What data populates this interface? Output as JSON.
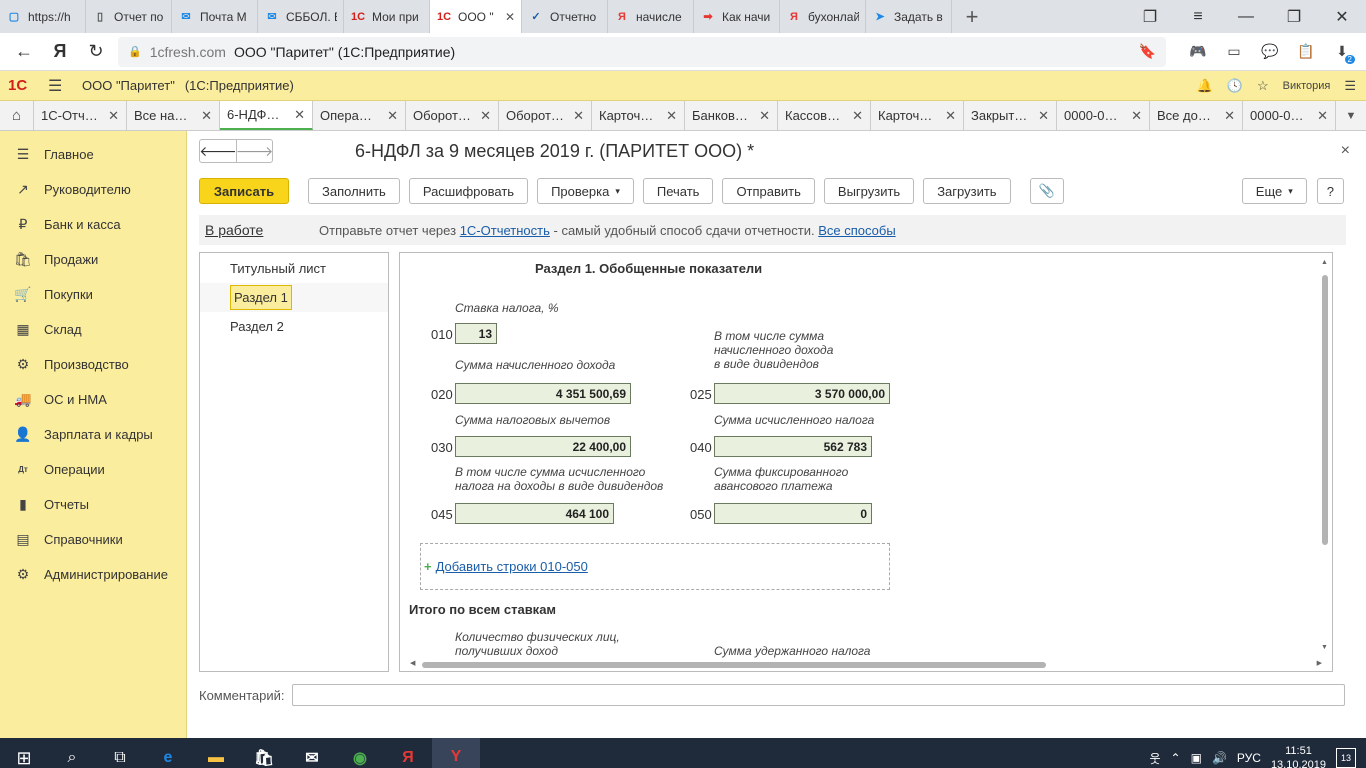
{
  "browser": {
    "tabs": [
      {
        "icon": "ie-icon",
        "glyph": "▢",
        "color": "#1e88e5",
        "title": "https://h"
      },
      {
        "icon": "doc-icon",
        "glyph": "▯",
        "color": "#555",
        "title": "Отчет по"
      },
      {
        "icon": "mail-icon",
        "glyph": "✉",
        "color": "#1e88e5",
        "title": "Почта М"
      },
      {
        "icon": "mail-icon",
        "glyph": "✉",
        "color": "#1e88e5",
        "title": "СББОЛ. В"
      },
      {
        "icon": "onec-icon",
        "glyph": "1С",
        "color": "#d3201a",
        "title": "Мои при"
      },
      {
        "icon": "onec-icon",
        "glyph": "1С",
        "color": "#d3201a",
        "title": "ООО \"",
        "active": true
      },
      {
        "icon": "check-icon",
        "glyph": "✓",
        "color": "#1a5da8",
        "title": "Отчетно"
      },
      {
        "icon": "yandex-icon",
        "glyph": "Я",
        "color": "#e53935",
        "title": "начисле"
      },
      {
        "icon": "arrow-icon",
        "glyph": "➡",
        "color": "#e53935",
        "title": "Как начи"
      },
      {
        "icon": "yandex-icon",
        "glyph": "Я",
        "color": "#e53935",
        "title": "бухонлай"
      },
      {
        "icon": "telegram-icon",
        "glyph": "➤",
        "color": "#1e88e5",
        "title": "Задать в"
      }
    ],
    "new_tab": "+",
    "window": {
      "collections": "❐",
      "menu": "≡",
      "minimize": "—",
      "restore": "❐",
      "close": "✕"
    },
    "nav": {
      "back": "←",
      "yandex": "Я",
      "reload": "↻"
    },
    "address": {
      "lock": "🔒",
      "domain": "1cfresh.com",
      "page_title": "ООО \"Паритет\" (1С:Предприятие)",
      "bookmark": "🔖"
    },
    "extensions": [
      {
        "name": "gamepad-icon",
        "glyph": "🎮"
      },
      {
        "name": "battery-icon",
        "glyph": "▭"
      },
      {
        "name": "chat-icon",
        "glyph": "💬"
      },
      {
        "name": "clipboard-icon",
        "glyph": "📋"
      },
      {
        "name": "download-icon",
        "glyph": "⬇",
        "badge": "2"
      }
    ]
  },
  "onec": {
    "logo": "1С",
    "menu": "☰",
    "app_name": "ООО \"Паритет\"",
    "app_suffix": "(1С:Предприятие)",
    "icons": {
      "bell": "🔔",
      "history": "🕓",
      "star": "☆",
      "more": "☰"
    },
    "user": "Виктория"
  },
  "section_tabs": {
    "home": "⌂",
    "close": "✕",
    "more": "▼",
    "items": [
      {
        "label": "1С-Отч…"
      },
      {
        "label": "Все на…"
      },
      {
        "label": "6-НДФ…",
        "active": true
      },
      {
        "label": "Опера…"
      },
      {
        "label": "Оборот…"
      },
      {
        "label": "Оборот…"
      },
      {
        "label": "Карточ…"
      },
      {
        "label": "Банков…"
      },
      {
        "label": "Кассов…"
      },
      {
        "label": "Карточ…"
      },
      {
        "label": "Закрыт…"
      },
      {
        "label": "0000-0…"
      },
      {
        "label": "Все до…"
      },
      {
        "label": "0000-0…"
      }
    ]
  },
  "sidebar": [
    {
      "label": "Главное",
      "icon": "☰",
      "name": "menu-icon"
    },
    {
      "label": "Руководителю",
      "icon": "↗",
      "name": "chart-icon"
    },
    {
      "label": "Банк и касса",
      "icon": "₽",
      "name": "ruble-icon"
    },
    {
      "label": "Продажи",
      "icon": "🛍",
      "name": "bag-icon"
    },
    {
      "label": "Покупки",
      "icon": "🛒",
      "name": "cart-icon"
    },
    {
      "label": "Склад",
      "icon": "▦",
      "name": "warehouse-icon"
    },
    {
      "label": "Производство",
      "icon": "⚙",
      "name": "factory-icon"
    },
    {
      "label": "ОС и НМА",
      "icon": "🚚",
      "name": "truck-icon"
    },
    {
      "label": "Зарплата и кадры",
      "icon": "👤",
      "name": "person-icon"
    },
    {
      "label": "Операции",
      "icon": "Дт",
      "name": "operations-icon"
    },
    {
      "label": "Отчеты",
      "icon": "▮",
      "name": "reports-icon"
    },
    {
      "label": "Справочники",
      "icon": "▤",
      "name": "books-icon"
    },
    {
      "label": "Администрирование",
      "icon": "⚙",
      "name": "gear-icon"
    }
  ],
  "document": {
    "back": "🡐",
    "forward": "🡒",
    "title": "6-НДФЛ за 9 месяцев 2019 г. (ПАРИТЕТ ООО) *",
    "close": "×",
    "toolbar": {
      "save": "Записать",
      "fill": "Заполнить",
      "decode": "Расшифровать",
      "check": "Проверка",
      "dropdown": "▾",
      "print": "Печать",
      "send": "Отправить",
      "export": "Выгрузить",
      "import": "Загрузить",
      "attach": "📎",
      "more": "Еще",
      "help": "?"
    },
    "status": {
      "label": "В работе",
      "hint_prefix": "Отправьте отчет через",
      "hint_link": "1С-Отчетность",
      "hint_middle": "- самый удобный способ сдачи отчетности.",
      "hint_link2": "Все способы"
    },
    "pages": [
      {
        "label": "Титульный лист"
      },
      {
        "label": "Раздел 1",
        "selected": true
      },
      {
        "label": "Раздел 2"
      }
    ],
    "section": {
      "title": "Раздел 1. Обобщенные показатели",
      "rate_label": "Ставка налога, %",
      "rate_code": "010",
      "rate_value": "13",
      "income_label": "Сумма начисленного дохода",
      "income_code": "020",
      "income_value": "4 351 500,69",
      "div_label_1": "В том числе сумма",
      "div_label_2": "начисленного дохода",
      "div_label_3": "в виде дивидендов",
      "div_code": "025",
      "div_value": "3 570 000,00",
      "deduct_label": "Сумма налоговых вычетов",
      "deduct_code": "030",
      "deduct_value": "22 400,00",
      "calc_label": "Сумма исчисленного налога",
      "calc_code": "040",
      "calc_value": "562 783",
      "divtax_label_1": "В том числе сумма исчисленного",
      "divtax_label_2": "налога на доходы в виде дивидендов",
      "divtax_code": "045",
      "divtax_value": "464 100",
      "fixed_label_1": "Сумма фиксированного",
      "fixed_label_2": "авансового платежа",
      "fixed_code": "050",
      "fixed_value": "0",
      "add_plus": "+",
      "add_rows": "Добавить строки 010-050",
      "total_title": "Итого по всем ставкам",
      "persons_label_1": "Количество физических лиц,",
      "persons_label_2": "получивших доход",
      "withheld_label": "Сумма удержанного налога"
    },
    "comment_label": "Комментарий:"
  },
  "taskbar": {
    "start": "⊞",
    "search": "⌕",
    "taskview": "⧉",
    "apps": [
      {
        "name": "edge-icon",
        "glyph": "e",
        "color": "#1e88e5"
      },
      {
        "name": "explorer-icon",
        "glyph": "▬",
        "color": "#f6c344"
      },
      {
        "name": "store-icon",
        "glyph": "🛍",
        "color": "#fff"
      },
      {
        "name": "mail-app-icon",
        "glyph": "✉",
        "color": "#fff"
      },
      {
        "name": "chrome-icon",
        "glyph": "◉",
        "color": "#4caf50"
      },
      {
        "name": "yandex-app-icon",
        "glyph": "Я",
        "color": "#e53935"
      },
      {
        "name": "yandex-browser-icon",
        "glyph": "Y",
        "color": "#e53935",
        "active": true
      }
    ],
    "tray": {
      "people": "웃",
      "chevron": "⌃",
      "network": "▣",
      "volume": "🔊",
      "lang": "РУС",
      "time": "11:51",
      "date": "13.10.2019",
      "notifications": "13"
    }
  }
}
